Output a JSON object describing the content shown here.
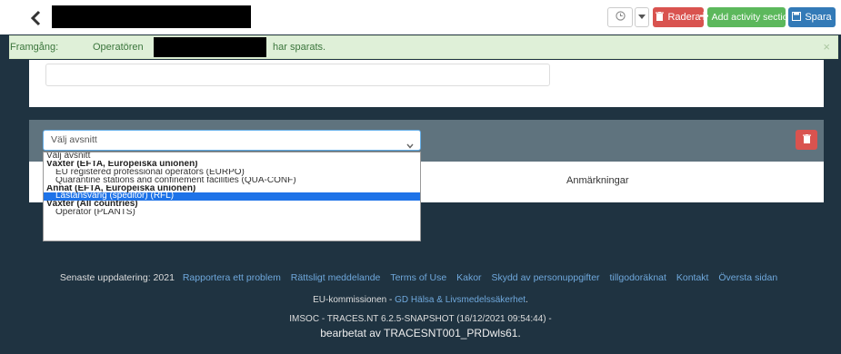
{
  "toolbar": {
    "delete_label": "Radera",
    "add_label": "Add activity section",
    "save_label": "Spara"
  },
  "alert": {
    "prefix": "Framgång:",
    "msg_before": "Operatören",
    "msg_after": "har sparats.",
    "close": "×"
  },
  "section": {
    "select_value": "Välj avsnitt",
    "remarks_label": "Anmärkningar"
  },
  "dropdown": {
    "options": [
      {
        "label": "Välj avsnitt",
        "kind": "option"
      },
      {
        "label": "Växter (EFTA, Europeiska unionen)",
        "kind": "group"
      },
      {
        "label": "EU registered professional operators (EURPO)",
        "kind": "option-indent"
      },
      {
        "label": "Quarantine stations and confinement facilities (QUA-CONF)",
        "kind": "option-indent"
      },
      {
        "label": "Annat (EFTA, Europeiska unionen)",
        "kind": "group"
      },
      {
        "label": "Lastansvarig (speditör) (RFL)",
        "kind": "option-indent",
        "selected": true
      },
      {
        "label": "Växter (All countries)",
        "kind": "group"
      },
      {
        "label": "Operatör (PLANTS)",
        "kind": "option-indent"
      }
    ]
  },
  "footer": {
    "last_updated": "Senaste uppdatering: 2021",
    "links": [
      "Rapportera ett problem",
      "Rättsligt meddelande",
      "Terms of Use",
      "Kakor",
      "Skydd av personuppgifter",
      "tillgodoräknat",
      "Kontakt",
      "Översta sidan"
    ],
    "commission": "EU-kommissionen",
    "separator": " - ",
    "dg_link": "GD Hälsa & Livsmedelssäkerhet",
    "dg_suffix": ".",
    "version": "IMSOC - TRACES.NT 6.2.5-SNAPSHOT (16/12/2021 09:54:44) -",
    "processed_by": "bearbetat av TRACESNT001_PRDwls61."
  }
}
